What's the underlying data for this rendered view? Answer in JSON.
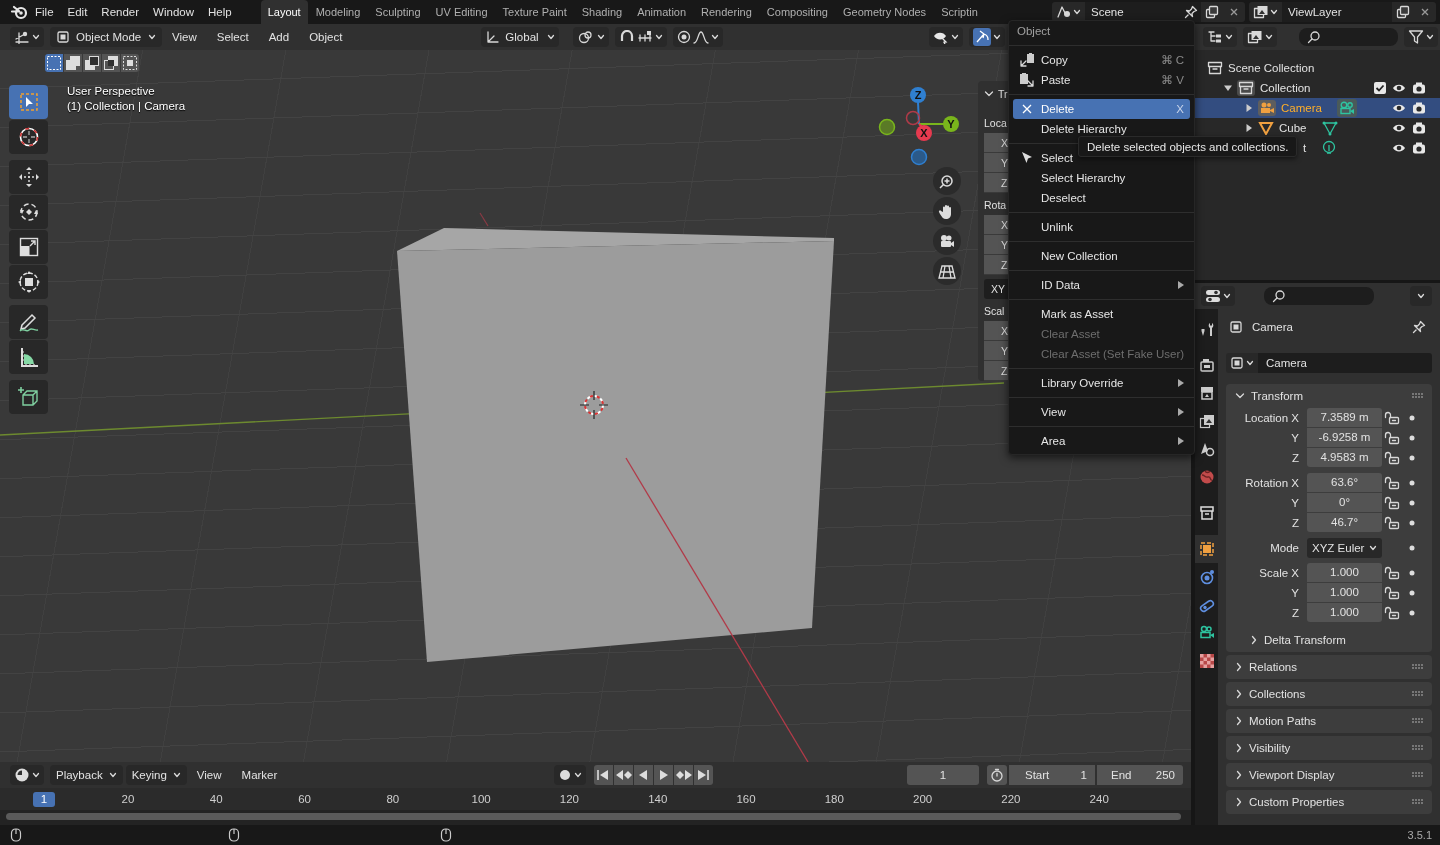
{
  "topbar": {
    "menus": [
      "File",
      "Edit",
      "Render",
      "Window",
      "Help"
    ],
    "workspaces": [
      {
        "label": "Layout",
        "selected": true
      },
      {
        "label": "Modeling",
        "selected": false
      },
      {
        "label": "Sculpting",
        "selected": false
      },
      {
        "label": "UV Editing",
        "selected": false
      },
      {
        "label": "Texture Paint",
        "selected": false
      },
      {
        "label": "Shading",
        "selected": false
      },
      {
        "label": "Animation",
        "selected": false
      },
      {
        "label": "Rendering",
        "selected": false
      },
      {
        "label": "Compositing",
        "selected": false
      },
      {
        "label": "Geometry Nodes",
        "selected": false
      },
      {
        "label": "Scriptin",
        "selected": false
      }
    ],
    "scene": "Scene",
    "view_layer": "ViewLayer"
  },
  "viewport": {
    "gizmos_on": true,
    "mode": "Object Mode",
    "menus": [
      "View",
      "Select",
      "Add",
      "Object"
    ],
    "orientation": "Global",
    "select_modes": [
      {
        "selected": true
      },
      {
        "selected": false
      },
      {
        "selected": false
      },
      {
        "selected": false
      },
      {
        "selected": false
      }
    ],
    "tools": [
      [
        {
          "kind": "select",
          "selected": true
        },
        {
          "kind": "cursor",
          "selected": false
        }
      ],
      [
        {
          "kind": "move",
          "selected": false
        },
        {
          "kind": "rotate",
          "selected": false
        },
        {
          "kind": "scale",
          "selected": false
        },
        {
          "kind": "transform",
          "selected": false
        }
      ],
      [
        {
          "kind": "annotate",
          "selected": false
        },
        {
          "kind": "measure",
          "selected": false
        }
      ],
      [
        {
          "kind": "add-cube",
          "selected": false
        }
      ]
    ],
    "view_name": "User Perspective",
    "context": "(1) Collection | Camera",
    "gizmo_axes": [
      "Z",
      "Y",
      "X"
    ],
    "sidebar": {
      "title": "Tr",
      "rows": [
        {
          "kind": "label",
          "text": "Loca"
        },
        {
          "kind": "field",
          "text": "X"
        },
        {
          "kind": "field",
          "text": "Y"
        },
        {
          "kind": "field",
          "text": "Z"
        },
        {
          "kind": "label",
          "text": "Rota"
        },
        {
          "kind": "field",
          "text": "X"
        },
        {
          "kind": "field",
          "text": "Y"
        },
        {
          "kind": "field",
          "text": "Z"
        },
        {
          "kind": "dropdown",
          "text": "XY"
        },
        {
          "kind": "label",
          "text": "Scal"
        },
        {
          "kind": "field",
          "text": "X"
        },
        {
          "kind": "field",
          "text": "Y"
        },
        {
          "kind": "field",
          "text": "Z"
        }
      ]
    }
  },
  "context_menu": {
    "title": "Object",
    "groups": [
      [
        {
          "kind": "copy",
          "label": "Copy",
          "shortcut": "⌘ C",
          "selected": false,
          "disabled": false,
          "submenu": false
        },
        {
          "kind": "paste",
          "label": "Paste",
          "shortcut": "⌘ V",
          "selected": false,
          "disabled": false,
          "submenu": false
        }
      ],
      [
        {
          "kind": "delete",
          "label": "Delete",
          "shortcut": "X",
          "selected": true,
          "disabled": false,
          "submenu": false
        },
        {
          "kind": "plain",
          "label": "Delete Hierarchy",
          "selected": false,
          "disabled": false,
          "submenu": false
        }
      ],
      [
        {
          "kind": "select",
          "label": "Select",
          "selected": false,
          "disabled": false,
          "submenu": false
        },
        {
          "kind": "plain",
          "label": "Select Hierarchy",
          "selected": false,
          "disabled": false,
          "submenu": false
        },
        {
          "kind": "plain",
          "label": "Deselect",
          "selected": false,
          "disabled": false,
          "submenu": false
        }
      ],
      [
        {
          "kind": "plain",
          "label": "Unlink",
          "selected": false,
          "disabled": false,
          "submenu": false
        }
      ],
      [
        {
          "kind": "plain",
          "label": "New Collection",
          "selected": false,
          "disabled": false,
          "submenu": false
        }
      ],
      [
        {
          "kind": "plain",
          "label": "ID Data",
          "selected": false,
          "disabled": false,
          "submenu": true
        }
      ],
      [
        {
          "kind": "plain",
          "label": "Mark as Asset",
          "selected": false,
          "disabled": false,
          "submenu": false
        },
        {
          "kind": "plain",
          "label": "Clear Asset",
          "selected": false,
          "disabled": true,
          "submenu": false
        },
        {
          "kind": "plain",
          "label": "Clear Asset (Set Fake User)",
          "selected": false,
          "disabled": true,
          "submenu": false
        }
      ],
      [
        {
          "kind": "plain",
          "label": "Library Override",
          "selected": false,
          "disabled": false,
          "submenu": true
        }
      ],
      [
        {
          "kind": "plain",
          "label": "View",
          "selected": false,
          "disabled": false,
          "submenu": true
        }
      ],
      [
        {
          "kind": "plain",
          "label": "Area",
          "selected": false,
          "disabled": false,
          "submenu": true
        }
      ]
    ]
  },
  "tooltip": "Delete selected objects and collections.",
  "outliner": {
    "root": "Scene Collection",
    "children": [
      {
        "kind": "collection",
        "name": "Collection",
        "expanded": true,
        "checked": true,
        "selected": false,
        "children": [
          {
            "kind": "camera",
            "name": "Camera",
            "expanded": false,
            "selected": true
          },
          {
            "kind": "mesh",
            "name": "Cube",
            "expanded": false,
            "selected": false
          },
          {
            "kind": "light",
            "name": "t",
            "selected": false
          }
        ]
      }
    ]
  },
  "properties": {
    "tabs": [
      {
        "kind": "tool",
        "selected": false
      },
      {
        "kind": "render",
        "selected": false
      },
      {
        "kind": "output",
        "selected": false
      },
      {
        "kind": "view-layer",
        "selected": false
      },
      {
        "kind": "scene",
        "selected": false
      },
      {
        "kind": "world",
        "selected": false
      },
      {
        "kind": "collection",
        "selected": false
      },
      {
        "kind": "object",
        "selected": true
      },
      {
        "kind": "physics",
        "selected": false
      },
      {
        "kind": "constraints",
        "selected": false
      },
      {
        "kind": "data",
        "selected": false
      },
      {
        "kind": "texture",
        "selected": false
      }
    ],
    "object_name": "Camera",
    "data_name": "Camera",
    "transform": {
      "title": "Transform",
      "expanded": true,
      "groups": [
        {
          "kind": "vector",
          "rows": [
            {
              "label": "Location X",
              "value": "7.3589 m",
              "locked": false
            },
            {
              "label": "Y",
              "value": "-6.9258 m",
              "locked": false
            },
            {
              "label": "Z",
              "value": "4.9583 m",
              "locked": false
            }
          ]
        },
        {
          "kind": "vector",
          "rows": [
            {
              "label": "Rotation X",
              "value": "63.6°",
              "locked": false
            },
            {
              "label": "Y",
              "value": "0°",
              "locked": false
            },
            {
              "label": "Z",
              "value": "46.7°",
              "locked": false
            }
          ]
        },
        {
          "kind": "dropdown",
          "rows": [
            {
              "label": "Mode",
              "value": "XYZ Euler"
            }
          ]
        },
        {
          "kind": "vector",
          "rows": [
            {
              "label": "Scale X",
              "value": "1.000",
              "locked": false
            },
            {
              "label": "Y",
              "value": "1.000",
              "locked": false
            },
            {
              "label": "Z",
              "value": "1.000",
              "locked": false
            }
          ]
        }
      ],
      "subpanels": [
        {
          "title": "Delta Transform",
          "expanded": false
        }
      ]
    },
    "panels": [
      {
        "title": "Relations",
        "expanded": false
      },
      {
        "title": "Collections",
        "expanded": false
      },
      {
        "title": "Motion Paths",
        "expanded": false
      },
      {
        "title": "Visibility",
        "expanded": false
      },
      {
        "title": "Viewport Display",
        "expanded": false
      },
      {
        "title": "Custom Properties",
        "expanded": false
      }
    ]
  },
  "timeline": {
    "menus": [
      {
        "kind": "dropdown",
        "label": "Playback"
      },
      {
        "kind": "dropdown",
        "label": "Keying"
      },
      {
        "kind": "menu",
        "label": "View"
      },
      {
        "kind": "menu",
        "label": "Marker"
      }
    ],
    "current_frame": "1",
    "start_label": "Start",
    "start": "1",
    "end_label": "End",
    "end": "250",
    "playhead": "1",
    "ruler": [
      "20",
      "40",
      "60",
      "80",
      "100",
      "120",
      "140",
      "160",
      "180",
      "200",
      "220",
      "240"
    ]
  },
  "status_bar": {
    "version": "3.5.1"
  }
}
